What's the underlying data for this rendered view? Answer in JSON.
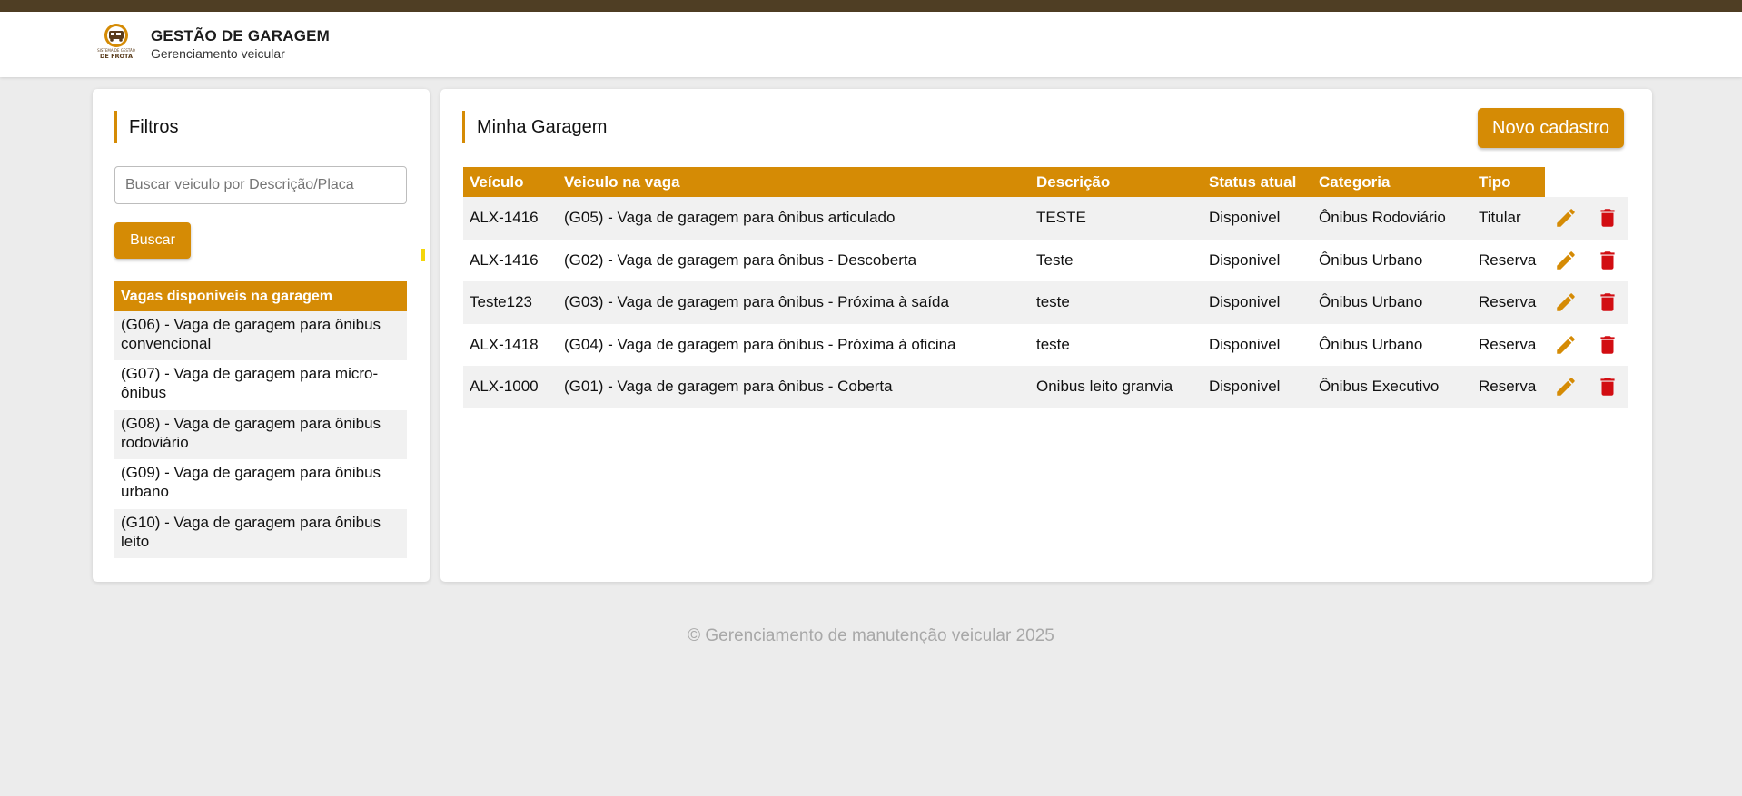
{
  "colors": {
    "accent": "#d58b05",
    "topbar": "#4f3e24",
    "danger": "#d20d12",
    "background": "#ececec"
  },
  "header": {
    "logo_lines": [
      "SISTEMA DE GESTÃO",
      "DE FROTA"
    ],
    "title": "GESTÃO DE GARAGEM",
    "subtitle": "Gerenciamento veicular"
  },
  "filters": {
    "title": "Filtros",
    "search_placeholder": "Buscar veiculo por Descrição/Placa",
    "search_value": "",
    "search_button": "Buscar",
    "slots_header": "Vagas disponiveis na garagem",
    "slots": [
      "(G06) - Vaga de garagem para ônibus convencional",
      "(G07) - Vaga de garagem para micro-ônibus",
      "(G08) - Vaga de garagem para ônibus rodoviário",
      "(G09) - Vaga de garagem para ônibus urbano",
      "(G10) - Vaga de garagem para ônibus leito"
    ]
  },
  "garage": {
    "title": "Minha Garagem",
    "new_button": "Novo cadastro",
    "columns": [
      "Veículo",
      "Veiculo na vaga",
      "Descrição",
      "Status atual",
      "Categoria",
      "Tipo"
    ],
    "rows": [
      [
        "ALX-1416",
        "(G05) - Vaga de garagem para ônibus articulado",
        "TESTE",
        "Disponivel",
        "Ônibus Rodoviário",
        "Titular"
      ],
      [
        "ALX-1416",
        "(G02) - Vaga de garagem para ônibus - Descoberta",
        "Teste",
        "Disponivel",
        "Ônibus Urbano",
        "Reserva"
      ],
      [
        "Teste123",
        "(G03) - Vaga de garagem para ônibus - Próxima à saída",
        "teste",
        "Disponivel",
        "Ônibus Urbano",
        "Reserva"
      ],
      [
        "ALX-1418",
        "(G04) - Vaga de garagem para ônibus - Próxima à oficina",
        "teste",
        "Disponivel",
        "Ônibus Urbano",
        "Reserva"
      ],
      [
        "ALX-1000",
        "(G01) - Vaga de garagem para ônibus - Coberta",
        "Onibus leito granvia",
        "Disponivel",
        "Ônibus Executivo",
        "Reserva"
      ]
    ],
    "row_actions": [
      "pencil-icon",
      "trash-icon"
    ]
  },
  "footer": {
    "text": "© Gerenciamento de manutenção veicular 2025"
  }
}
